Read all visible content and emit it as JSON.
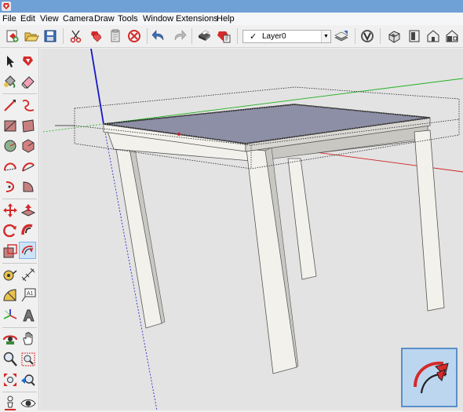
{
  "app": {
    "title_icon": "sketchup-logo-icon",
    "accent": "#6fa0d6"
  },
  "menu": {
    "items": [
      "File",
      "Edit",
      "View",
      "Camera",
      "Draw",
      "Tools",
      "Window",
      "Extensions",
      "Help"
    ]
  },
  "toolbar": {
    "buttons": [
      {
        "name": "new-model-icon"
      },
      {
        "name": "open-folder-icon"
      },
      {
        "name": "save-icon"
      },
      {
        "name": "cut-icon"
      },
      {
        "name": "copy-icon"
      },
      {
        "name": "paste-icon"
      },
      {
        "name": "erase-icon"
      },
      {
        "name": "undo-icon"
      },
      {
        "name": "redo-icon"
      },
      {
        "name": "print-icon"
      },
      {
        "name": "model-info-icon"
      },
      {
        "name": "layer-manager-icon"
      },
      {
        "name": "components-icon"
      },
      {
        "name": "iso-view-icon"
      },
      {
        "name": "top-view-icon"
      },
      {
        "name": "front-view-icon"
      },
      {
        "name": "right-view-icon"
      }
    ],
    "layer": {
      "check": "✓",
      "selected": "Layer0"
    }
  },
  "left_toolbar": {
    "tools": [
      "select-icon",
      "make-component-icon",
      "paint-bucket-icon",
      "eraser-icon",
      "line-icon",
      "freehand-icon",
      "rectangle-icon",
      "rotated-rectangle-icon",
      "circle-icon",
      "polygon-icon",
      "arc-icon",
      "two-point-arc-icon",
      "three-point-arc-icon",
      "pie-icon",
      "move-icon",
      "push-pull-icon",
      "rotate-icon",
      "follow-me-icon",
      "scale-icon",
      "offset-icon",
      "tape-measure-icon",
      "dimension-icon",
      "protractor-icon",
      "text-icon",
      "axes-icon",
      "3d-text-icon",
      "orbit-icon",
      "pan-icon",
      "zoom-icon",
      "zoom-window-icon",
      "zoom-extents-icon",
      "previous-view-icon",
      "position-camera-icon",
      "look-around-icon"
    ],
    "active_tool": "offset-icon"
  },
  "viewport": {
    "background": "#e3e3e3",
    "colors": {
      "axis_red": "#d02020",
      "axis_green": "#20b020",
      "axis_blue": "#1818c8",
      "table_face": "#f3f1ec",
      "table_shadow": "#c9c7c2",
      "selection_fill": "#8d8fa6",
      "badge_bg": "#bcd6f0"
    },
    "active_tool_badge": "offset-icon"
  }
}
